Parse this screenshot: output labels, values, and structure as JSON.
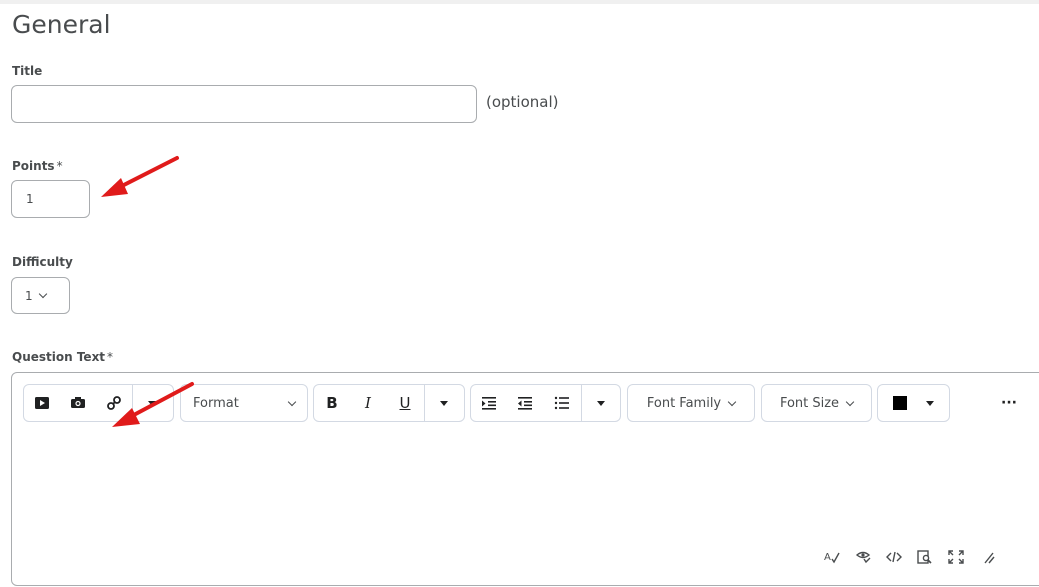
{
  "section": {
    "heading": "General"
  },
  "title_field": {
    "label": "Title",
    "value": "",
    "suffix": "(optional)"
  },
  "points_field": {
    "label": "Points",
    "required_mark": "*",
    "value": "1"
  },
  "difficulty_field": {
    "label": "Difficulty",
    "selected": "1"
  },
  "question_text": {
    "label": "Question Text",
    "required_mark": "*",
    "toolbar": {
      "format_label": "Format",
      "bold_label": "B",
      "italic_label": "I",
      "underline_label": "U",
      "font_family_label": "Font Family",
      "font_size_label": "Font Size",
      "more_label": "···",
      "text_color": "#000000"
    },
    "body": "",
    "footer_icons": [
      "spellcheck-icon",
      "accessibility-check-icon",
      "source-code-icon",
      "preview-icon",
      "fullscreen-icon",
      "resize-handle-icon"
    ]
  },
  "annotations": {
    "arrow_color": "#e01b1b"
  }
}
